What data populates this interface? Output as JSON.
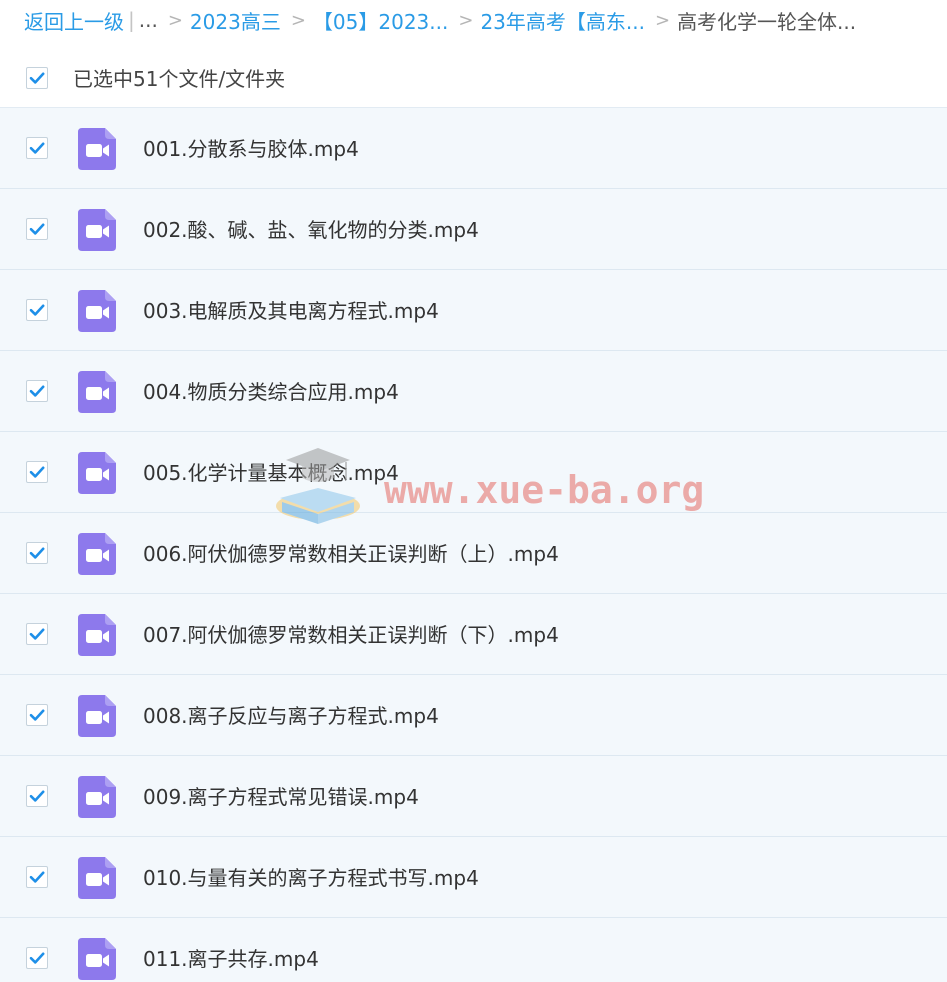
{
  "breadcrumb": {
    "back_label": "返回上一级",
    "pipe": "|",
    "ellipsis": "...",
    "separator": ">",
    "items": [
      "2023高三",
      "【05】2023...",
      "23年高考【高东..."
    ],
    "current": "高考化学一轮全体..."
  },
  "selection": {
    "label": "已选中51个文件/文件夹",
    "checked": true
  },
  "files": [
    {
      "name": "001.分散系与胶体.mp4",
      "checked": true
    },
    {
      "name": "002.酸、碱、盐、氧化物的分类.mp4",
      "checked": true
    },
    {
      "name": "003.电解质及其电离方程式.mp4",
      "checked": true
    },
    {
      "name": "004.物质分类综合应用.mp4",
      "checked": true
    },
    {
      "name": "005.化学计量基本概念.mp4",
      "checked": true
    },
    {
      "name": "006.阿伏伽德罗常数相关正误判断（上）.mp4",
      "checked": true
    },
    {
      "name": "007.阿伏伽德罗常数相关正误判断（下）.mp4",
      "checked": true
    },
    {
      "name": "008.离子反应与离子方程式.mp4",
      "checked": true
    },
    {
      "name": "009.离子方程式常见错误.mp4",
      "checked": true
    },
    {
      "name": "010.与量有关的离子方程式书写.mp4",
      "checked": true
    },
    {
      "name": "011.离子共存.mp4",
      "checked": true
    }
  ],
  "watermark": {
    "text": "www.xue-ba.org",
    "icon": "graduation-cap-book-icon"
  },
  "colors": {
    "link": "#2a9be6",
    "check": "#1e8fe8",
    "video_icon": "#8d79ec",
    "row_bg": "#f3f8fc",
    "watermark": "#e98d89"
  },
  "icons": {
    "checkbox": "checkmark-icon",
    "file": "video-file-icon"
  }
}
